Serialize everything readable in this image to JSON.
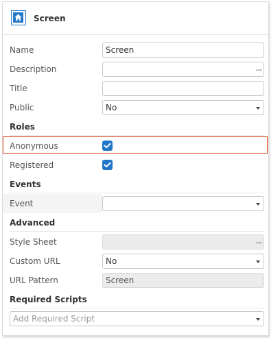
{
  "header": {
    "title": "Screen",
    "icon": "home-icon"
  },
  "fields": {
    "name": {
      "label": "Name",
      "value": "Screen"
    },
    "description": {
      "label": "Description",
      "value": "",
      "button": "..."
    },
    "title": {
      "label": "Title",
      "value": ""
    },
    "public": {
      "label": "Public",
      "value": "No"
    }
  },
  "roles": {
    "heading": "Roles",
    "anonymous": {
      "label": "Anonymous",
      "checked": true
    },
    "registered": {
      "label": "Registered",
      "checked": true
    }
  },
  "events": {
    "heading": "Events",
    "event": {
      "label": "Event",
      "value": ""
    }
  },
  "advanced": {
    "heading": "Advanced",
    "style_sheet": {
      "label": "Style Sheet",
      "value": "",
      "button": "..."
    },
    "custom_url": {
      "label": "Custom URL",
      "value": "No"
    },
    "url_pattern": {
      "label": "URL Pattern",
      "value": "Screen"
    }
  },
  "required_scripts": {
    "heading": "Required Scripts",
    "placeholder": "Add Required Script"
  },
  "colors": {
    "accent": "#2277c8",
    "highlight": "#d9451f"
  }
}
